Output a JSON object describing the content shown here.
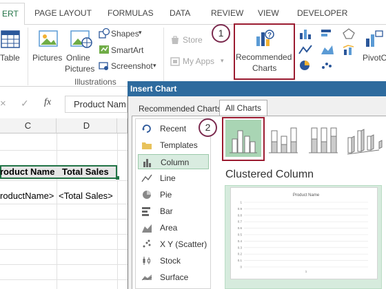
{
  "ribbon_tabs": [
    "ERT",
    "PAGE LAYOUT",
    "FORMULAS",
    "DATA",
    "REVIEW",
    "VIEW",
    "DEVELOPER"
  ],
  "ribbon": {
    "table_label": "Table",
    "pictures_label": "Pictures",
    "online_pictures_label": [
      "Online",
      "Pictures"
    ],
    "shapes_label": "Shapes",
    "smartart_label": "SmartArt",
    "screenshot_label": "Screenshot",
    "illustrations_group": "Illustrations",
    "store_label": "Store",
    "myapps_label": "My Apps",
    "recommended_charts_label": [
      "Recommended",
      "Charts"
    ],
    "pivot_label": "PivotC"
  },
  "callouts": [
    "1",
    "2"
  ],
  "formula_bar": {
    "name_box_value": "Product Nam",
    "fx_label": "fx"
  },
  "grid": {
    "columns": [
      "C",
      "D"
    ],
    "row_headers": [
      "roduct Name",
      "Total Sales"
    ],
    "row_values": [
      "roductName>",
      "<Total Sales>"
    ]
  },
  "dialog": {
    "title": "Insert Chart",
    "tabs": [
      "Recommended Charts",
      "All Charts"
    ],
    "active_tab": "All Charts",
    "chart_types": [
      "Recent",
      "Templates",
      "Column",
      "Line",
      "Pie",
      "Bar",
      "Area",
      "X Y (Scatter)",
      "Stock",
      "Surface"
    ],
    "selected_type": "Column",
    "subtype_title": "Clustered Column",
    "preview_title": "Product Name",
    "preview_ticks": [
      "1",
      "0.9",
      "0.8",
      "0.7",
      "0.6",
      "0.5",
      "0.4",
      "0.3",
      "0.2",
      "0.1",
      "0"
    ],
    "preview_xtick": "1"
  },
  "colors": {
    "excel_green": "#217346",
    "dialog_title_bg": "#2e6b9e",
    "callout_border": "#7b2a4e",
    "highlight_border": "#9b1b30",
    "selection_green": "#d9ece0"
  }
}
